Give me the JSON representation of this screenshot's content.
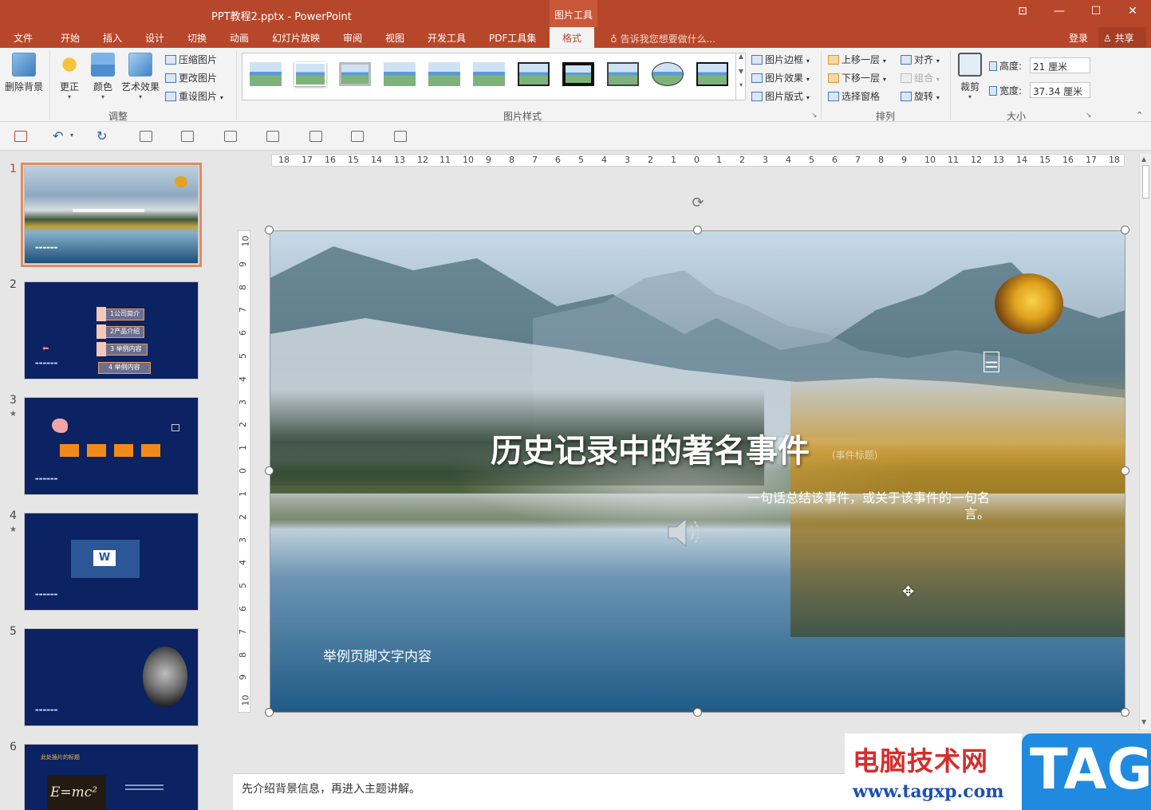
{
  "titlebar": {
    "doc_title": "PPT教程2.pptx - PowerPoint",
    "context_tool": "图片工具",
    "controls": [
      "⊡",
      "—",
      "☐",
      "✕"
    ]
  },
  "tabs": [
    "文件",
    "开始",
    "插入",
    "设计",
    "切换",
    "动画",
    "幻灯片放映",
    "审阅",
    "视图",
    "开发工具",
    "PDF工具集",
    "格式"
  ],
  "active_tab": "格式",
  "tell_me": "告诉我您想要做什么...",
  "login": "登录",
  "share": "共享",
  "ribbon": {
    "remove_bg": "删除背景",
    "correct": "更正",
    "color": "颜色",
    "art_effects": "艺术效果",
    "compress": "压缩图片",
    "change_pic": "更改图片",
    "reset_pic": "重设图片",
    "group_adjust": "调整",
    "group_styles": "图片样式",
    "pic_border": "图片边框",
    "pic_effects": "图片效果",
    "pic_layout": "图片版式",
    "bring_forward": "上移一层",
    "send_backward": "下移一层",
    "selection_pane": "选择窗格",
    "align": "对齐",
    "group": "组合",
    "rotate": "旋转",
    "group_arrange": "排列",
    "crop": "裁剪",
    "height_label": "高度:",
    "height_value": "21 厘米",
    "width_label": "宽度:",
    "width_value": "37.34 厘米",
    "group_size": "大小"
  },
  "thumbnails": [
    {
      "num": "1",
      "star": ""
    },
    {
      "num": "2",
      "star": "",
      "items": [
        "1公司简介",
        "2产品介绍",
        "3 举例内容",
        "4 举例内容"
      ]
    },
    {
      "num": "3",
      "star": "★"
    },
    {
      "num": "4",
      "star": "★"
    },
    {
      "num": "5",
      "star": ""
    },
    {
      "num": "6",
      "star": "",
      "title": "此处插片的标题",
      "formula": "E=mc²"
    }
  ],
  "ruler_h": [
    "18",
    "17",
    "16",
    "15",
    "14",
    "13",
    "12",
    "11",
    "10",
    "9",
    "8",
    "7",
    "6",
    "5",
    "4",
    "3",
    "2",
    "1",
    "0",
    "1",
    "2",
    "3",
    "4",
    "5",
    "6",
    "7",
    "8",
    "9",
    "10",
    "11",
    "12",
    "13",
    "14",
    "15",
    "16",
    "17",
    "18"
  ],
  "ruler_v": [
    "10",
    "9",
    "8",
    "7",
    "6",
    "5",
    "4",
    "3",
    "2",
    "1",
    "0",
    "1",
    "2",
    "3",
    "4",
    "5",
    "6",
    "7",
    "8",
    "9",
    "10"
  ],
  "slide": {
    "title": "历史记录中的著名事件",
    "title_hint": "(事件标题)",
    "quote": "一句话总结该事件，或关于该事件的一句名言。",
    "footer": "举例页脚文字内容"
  },
  "notes": "先介绍背景信息，再进入主题讲解。",
  "watermark": {
    "cn": "电脑技术网",
    "url": "www.tagxp.com",
    "tag": "TAG"
  }
}
